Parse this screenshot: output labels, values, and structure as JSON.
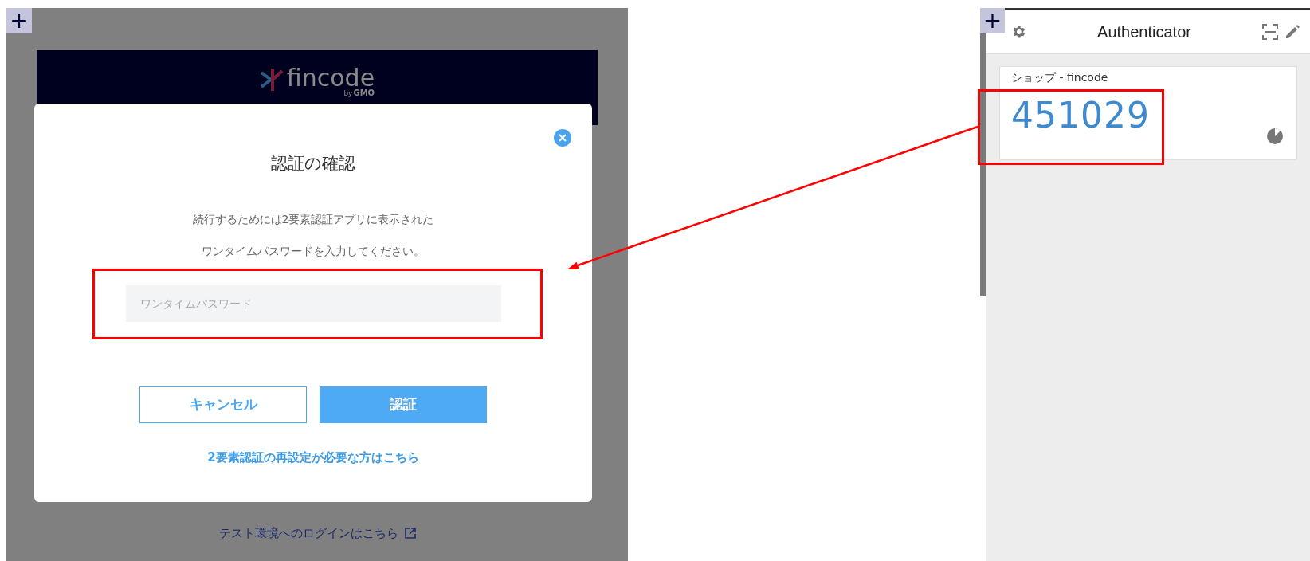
{
  "left_page": {
    "corner_button": "+",
    "logo": {
      "name": "fincode",
      "byline_prefix": "by",
      "byline": "GMO"
    },
    "background_link": "テスト環境へのログインはこちら"
  },
  "dialog": {
    "title": "認証の確認",
    "message_lines": [
      "続行するためには2要素認証アプリに表示された",
      "ワンタイムパスワードを入力してください。"
    ],
    "input": {
      "placeholder": "ワンタイムパスワード"
    },
    "buttons": [
      {
        "label": "キャンセル",
        "kind": "secondary"
      },
      {
        "label": "認証",
        "kind": "primary"
      }
    ],
    "reset_link": "2要素認証の再設定が必要な方はこちら"
  },
  "authenticator": {
    "corner_button": "+",
    "title": "Authenticator",
    "accounts": [
      {
        "name": "ショップ - fincode",
        "code": "451029"
      }
    ]
  }
}
